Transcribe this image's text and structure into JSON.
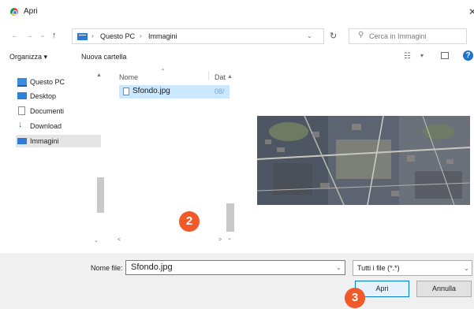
{
  "window": {
    "title": "Apri"
  },
  "address": {
    "crumbs": [
      "Questo PC",
      "Immagini"
    ],
    "separator": "›"
  },
  "search": {
    "placeholder": "Cerca in Immagini"
  },
  "toolbar": {
    "organize": "Organizza ▾",
    "new_folder": "Nuova cartella"
  },
  "nav": {
    "items": [
      {
        "label": "Questo PC",
        "icon": "computer-icon"
      },
      {
        "label": "Desktop",
        "icon": "desktop-icon"
      },
      {
        "label": "Documenti",
        "icon": "documents-icon"
      },
      {
        "label": "Download",
        "icon": "download-icon"
      },
      {
        "label": "Immagini",
        "icon": "pictures-icon"
      }
    ]
  },
  "list": {
    "columns": [
      "Nome",
      "Dat"
    ],
    "file_name": "Sfondo.jpg",
    "file_date": "08/"
  },
  "bottom": {
    "filename_label": "Nome file:",
    "filename_value": "Sfondo.jpg",
    "filetype": "Tutti i file (*.*)",
    "open_label": "Apri",
    "cancel_label": "Annulla"
  },
  "badges": {
    "step2": "2",
    "step3": "3"
  },
  "colors": {
    "badge": "#f05a28",
    "accent": "#0078d7",
    "selection": "#cce8ff"
  }
}
